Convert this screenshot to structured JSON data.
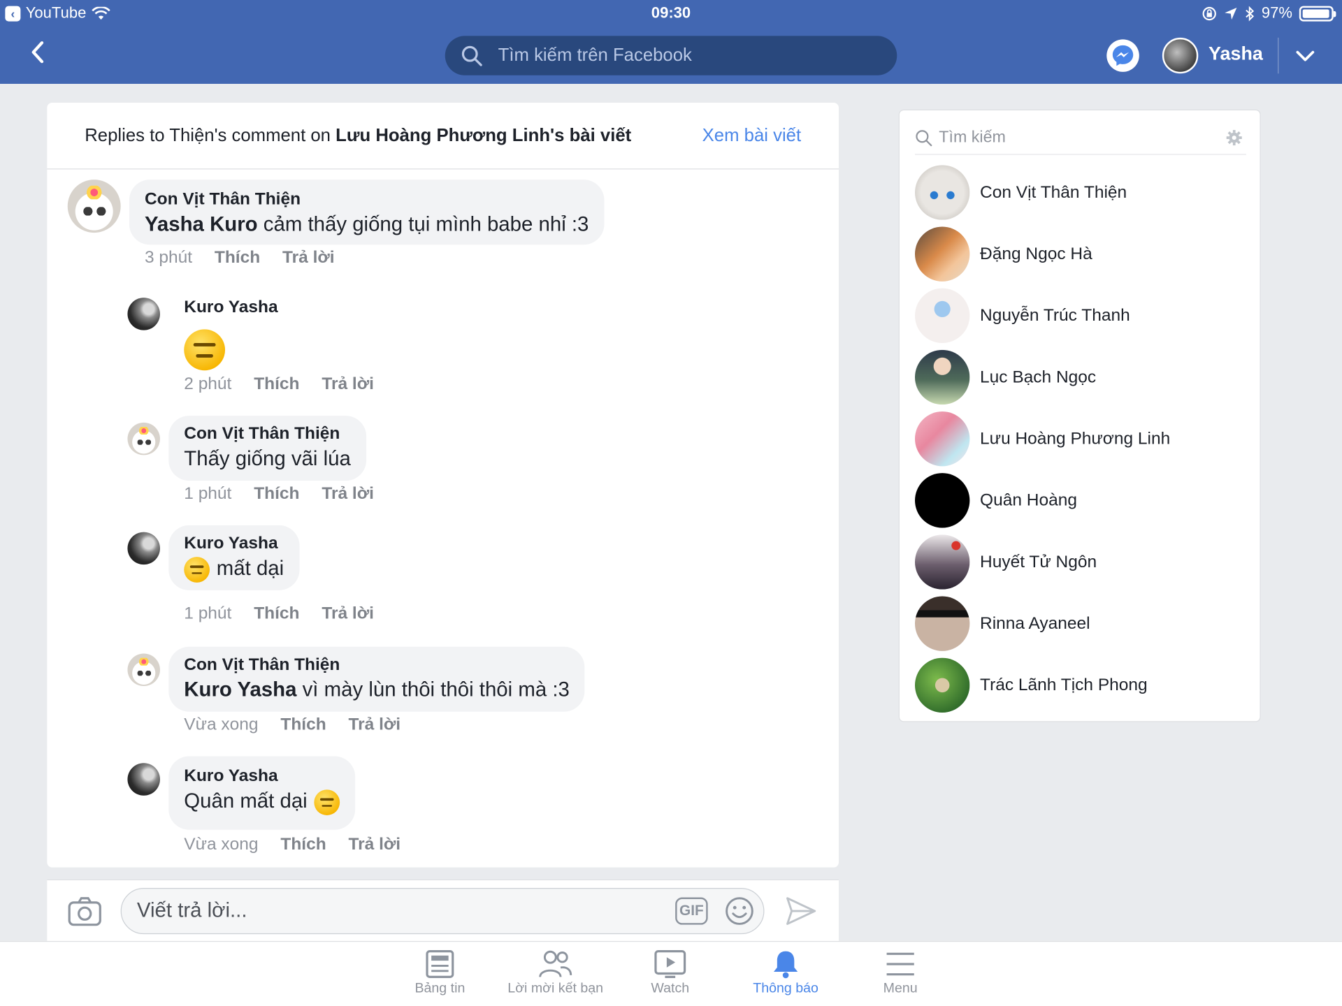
{
  "status_bar": {
    "back_app": "YouTube",
    "time": "09:30",
    "battery": "97%",
    "battery_level": 0.97
  },
  "header": {
    "search_placeholder": "Tìm kiếm trên Facebook",
    "user_name": "Yasha"
  },
  "thread": {
    "title_prefix": "Replies to Thiện's comment on ",
    "title_owner": "Lưu Hoàng Phương Linh",
    "title_suffix": "'s bài viết",
    "view_post": "Xem bài viết",
    "like_label": "Thích",
    "reply_label": "Trả lời",
    "comments": [
      {
        "author": "Con Vịt Thân Thiện",
        "mention": "Yasha Kuro",
        "text": " cảm thấy giống tụi mình babe nhỉ :3",
        "time": "3 phút"
      },
      {
        "author": "Kuro Yasha",
        "mention": "",
        "text": "",
        "time": "2 phút"
      },
      {
        "author": "Con Vịt Thân Thiện",
        "mention": "",
        "text": "Thấy giống vãi lúa",
        "time": "1 phút"
      },
      {
        "author": "Kuro Yasha",
        "mention": "",
        "text": "mất dại",
        "time": "1 phút"
      },
      {
        "author": "Con Vịt Thân Thiện",
        "mention": "Kuro Yasha",
        "text": " vì mày lùn thôi thôi thôi mà :3",
        "time": "Vừa xong"
      },
      {
        "author": "Kuro Yasha",
        "mention": "",
        "text": "Quân mất dại",
        "time": "Vừa xong"
      }
    ]
  },
  "reply_bar": {
    "placeholder": "Viết trả lời...",
    "gif_label": "GIF"
  },
  "sidebar": {
    "search_placeholder": "Tìm kiếm",
    "friends": [
      {
        "name": "Con Vịt Thân Thiện"
      },
      {
        "name": "Đặng Ngọc Hà"
      },
      {
        "name": "Nguyễn Trúc Thanh"
      },
      {
        "name": "Lục Bạch Ngọc"
      },
      {
        "name": "Lưu Hoàng Phương Linh"
      },
      {
        "name": "Quân Hoàng"
      },
      {
        "name": "Huyết Tử Ngôn"
      },
      {
        "name": "Rinna Ayaneel"
      },
      {
        "name": "Trác Lãnh Tịch Phong"
      }
    ]
  },
  "tabs": [
    {
      "label": "Bảng tin",
      "icon": "news-feed-icon"
    },
    {
      "label": "Lời mời kết bạn",
      "icon": "friends-icon"
    },
    {
      "label": "Watch",
      "icon": "watch-icon"
    },
    {
      "label": "Thông báo",
      "icon": "bell-icon",
      "active": true
    },
    {
      "label": "Menu",
      "icon": "menu-icon"
    }
  ],
  "colors": {
    "brand": "#4267b2",
    "link": "#4a86e8"
  }
}
